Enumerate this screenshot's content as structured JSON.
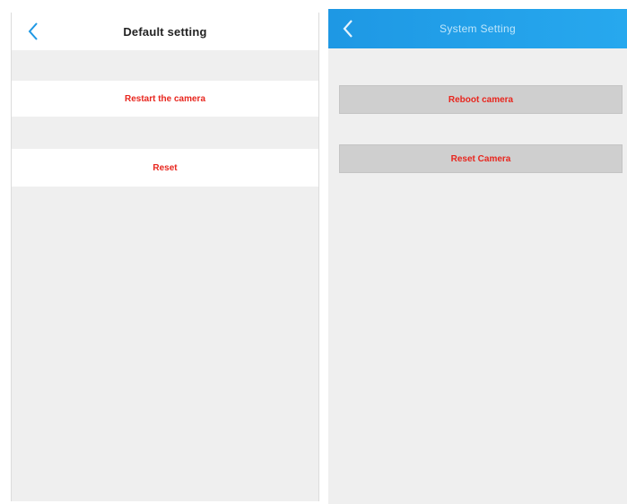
{
  "left_screen": {
    "header": {
      "title": "Default setting",
      "back_icon": "chevron-left-icon"
    },
    "rows": [
      {
        "label": "Restart the camera"
      },
      {
        "label": "Reset"
      }
    ]
  },
  "right_screen": {
    "header": {
      "title": "System Setting",
      "back_icon": "chevron-left-icon"
    },
    "buttons": [
      {
        "label": "Reboot camera"
      },
      {
        "label": "Reset Camera"
      }
    ]
  },
  "colors": {
    "accent_blue": "#1ea0e8",
    "action_red": "#e8261e",
    "background_gray": "#efefef",
    "button_gray": "#cfcfcf"
  }
}
